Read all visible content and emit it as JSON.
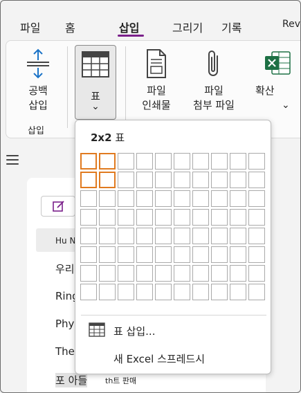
{
  "tabs": [
    {
      "label": "파일",
      "active": false
    },
    {
      "label": "홈",
      "active": false
    },
    {
      "label": "삽입",
      "active": true
    },
    {
      "label": "그리기",
      "active": false
    },
    {
      "label": "기록",
      "active": false
    },
    {
      "label": "Rev",
      "active": false
    }
  ],
  "ribbon": {
    "space_button": {
      "line1": "공백",
      "line2": "삽입",
      "icon": "insert-space-icon"
    },
    "group_label": "삽입",
    "table_button": {
      "label": "표",
      "icon": "table-icon",
      "caret": "⌄"
    },
    "file_printout": {
      "line1": "파일",
      "line2": "인쇄물",
      "icon": "file-printout-icon"
    },
    "file_attach": {
      "line1": "파일",
      "line2": "첨부 파일",
      "icon": "paperclip-icon"
    },
    "extend": {
      "label": "확산",
      "icon": "excel-icon",
      "caret": "⌄"
    }
  },
  "colors": {
    "accent": "#7a1f8a",
    "grid_highlight": "#e07a1f",
    "excel_green": "#1d7044"
  },
  "pages": {
    "items": [
      "Hu N",
      "우리",
      "Ring",
      "Phy",
      "The",
      "포 아들",
      "th트 판매"
    ]
  },
  "table_menu": {
    "size_text": "2x2",
    "size_suffix": " 표",
    "rows": 8,
    "cols": 10,
    "selected_rows": 2,
    "selected_cols": 2,
    "insert_table_label": "표 삽입...",
    "new_excel_label": "새 Excel 스프레드시"
  }
}
